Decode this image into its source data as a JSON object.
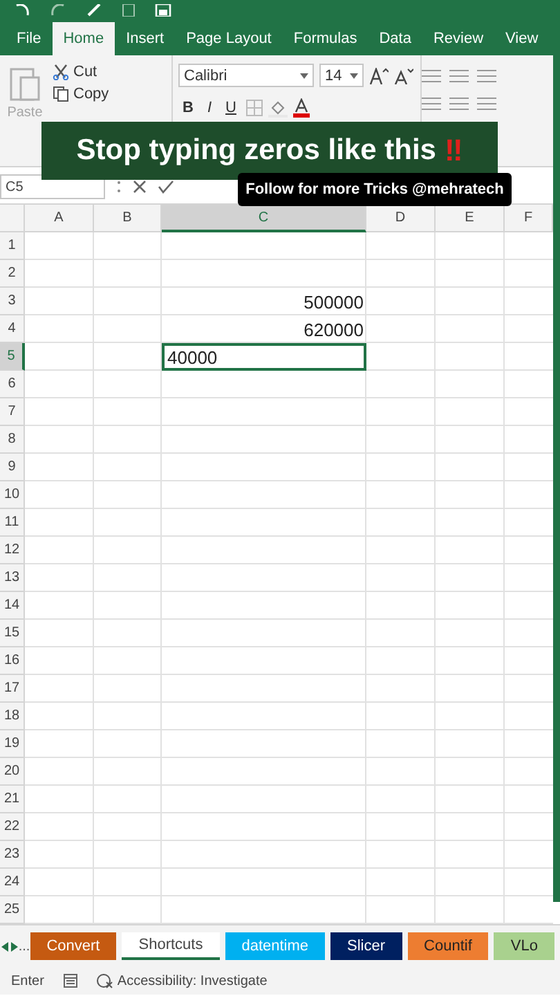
{
  "ribbon_tabs": [
    {
      "label": "File",
      "selected": false
    },
    {
      "label": "Home",
      "selected": true
    },
    {
      "label": "Insert",
      "selected": false
    },
    {
      "label": "Page Layout",
      "selected": false
    },
    {
      "label": "Formulas",
      "selected": false
    },
    {
      "label": "Data",
      "selected": false
    },
    {
      "label": "Review",
      "selected": false
    },
    {
      "label": "View",
      "selected": false
    }
  ],
  "clipboard": {
    "paste": "Paste",
    "cut": "Cut",
    "copy": "Copy"
  },
  "font": {
    "name": "Calibri",
    "size": "14",
    "bold": "B",
    "italic": "I",
    "underline": "U"
  },
  "name_box": "C5",
  "columns": [
    {
      "label": "A",
      "selected": false
    },
    {
      "label": "B",
      "selected": false
    },
    {
      "label": "C",
      "selected": true
    },
    {
      "label": "D",
      "selected": false
    },
    {
      "label": "E",
      "selected": false
    },
    {
      "label": "F",
      "selected": false
    }
  ],
  "rows": [
    {
      "number": "1",
      "selected": false
    },
    {
      "number": "2",
      "selected": false
    },
    {
      "number": "3",
      "selected": false,
      "column_c": {
        "text": "500000",
        "kind": "number",
        "active": false
      }
    },
    {
      "number": "4",
      "selected": false,
      "column_c": {
        "text": "620000",
        "kind": "number",
        "active": false
      }
    },
    {
      "number": "5",
      "selected": true,
      "column_c": {
        "text": "40000",
        "kind": "text",
        "active": true
      }
    },
    {
      "number": "6",
      "selected": false
    },
    {
      "number": "7",
      "selected": false
    },
    {
      "number": "8",
      "selected": false
    },
    {
      "number": "9",
      "selected": false
    },
    {
      "number": "10",
      "selected": false
    },
    {
      "number": "11",
      "selected": false
    },
    {
      "number": "12",
      "selected": false
    },
    {
      "number": "13",
      "selected": false
    },
    {
      "number": "14",
      "selected": false
    },
    {
      "number": "15",
      "selected": false
    },
    {
      "number": "16",
      "selected": false
    },
    {
      "number": "17",
      "selected": false
    },
    {
      "number": "18",
      "selected": false
    },
    {
      "number": "19",
      "selected": false
    },
    {
      "number": "20",
      "selected": false
    },
    {
      "number": "21",
      "selected": false
    },
    {
      "number": "22",
      "selected": false
    },
    {
      "number": "23",
      "selected": false
    },
    {
      "number": "24",
      "selected": false
    },
    {
      "number": "25",
      "selected": false
    }
  ],
  "sheet_nav": {
    "more": "..."
  },
  "sheet_tabs": [
    {
      "label": "Convert",
      "selected": false,
      "color": "#c55a11"
    },
    {
      "label": "Shortcuts",
      "selected": true,
      "color": "#ffffff"
    },
    {
      "label": "datentime",
      "selected": false,
      "color": "#00b0f0"
    },
    {
      "label": "Slicer",
      "selected": false,
      "color": "#002060"
    },
    {
      "label": "Countif",
      "selected": false,
      "color": "#ed7d31"
    },
    {
      "label": "VLo",
      "selected": false,
      "color": "#a9d18e"
    }
  ],
  "status_bar": {
    "mode": "Enter",
    "accessibility": "Accessibility: Investigate"
  },
  "overlay": {
    "headline": "Stop typing zeros like this",
    "headline_mark": "‼",
    "tagline": "Follow for more Tricks @mehratech"
  }
}
